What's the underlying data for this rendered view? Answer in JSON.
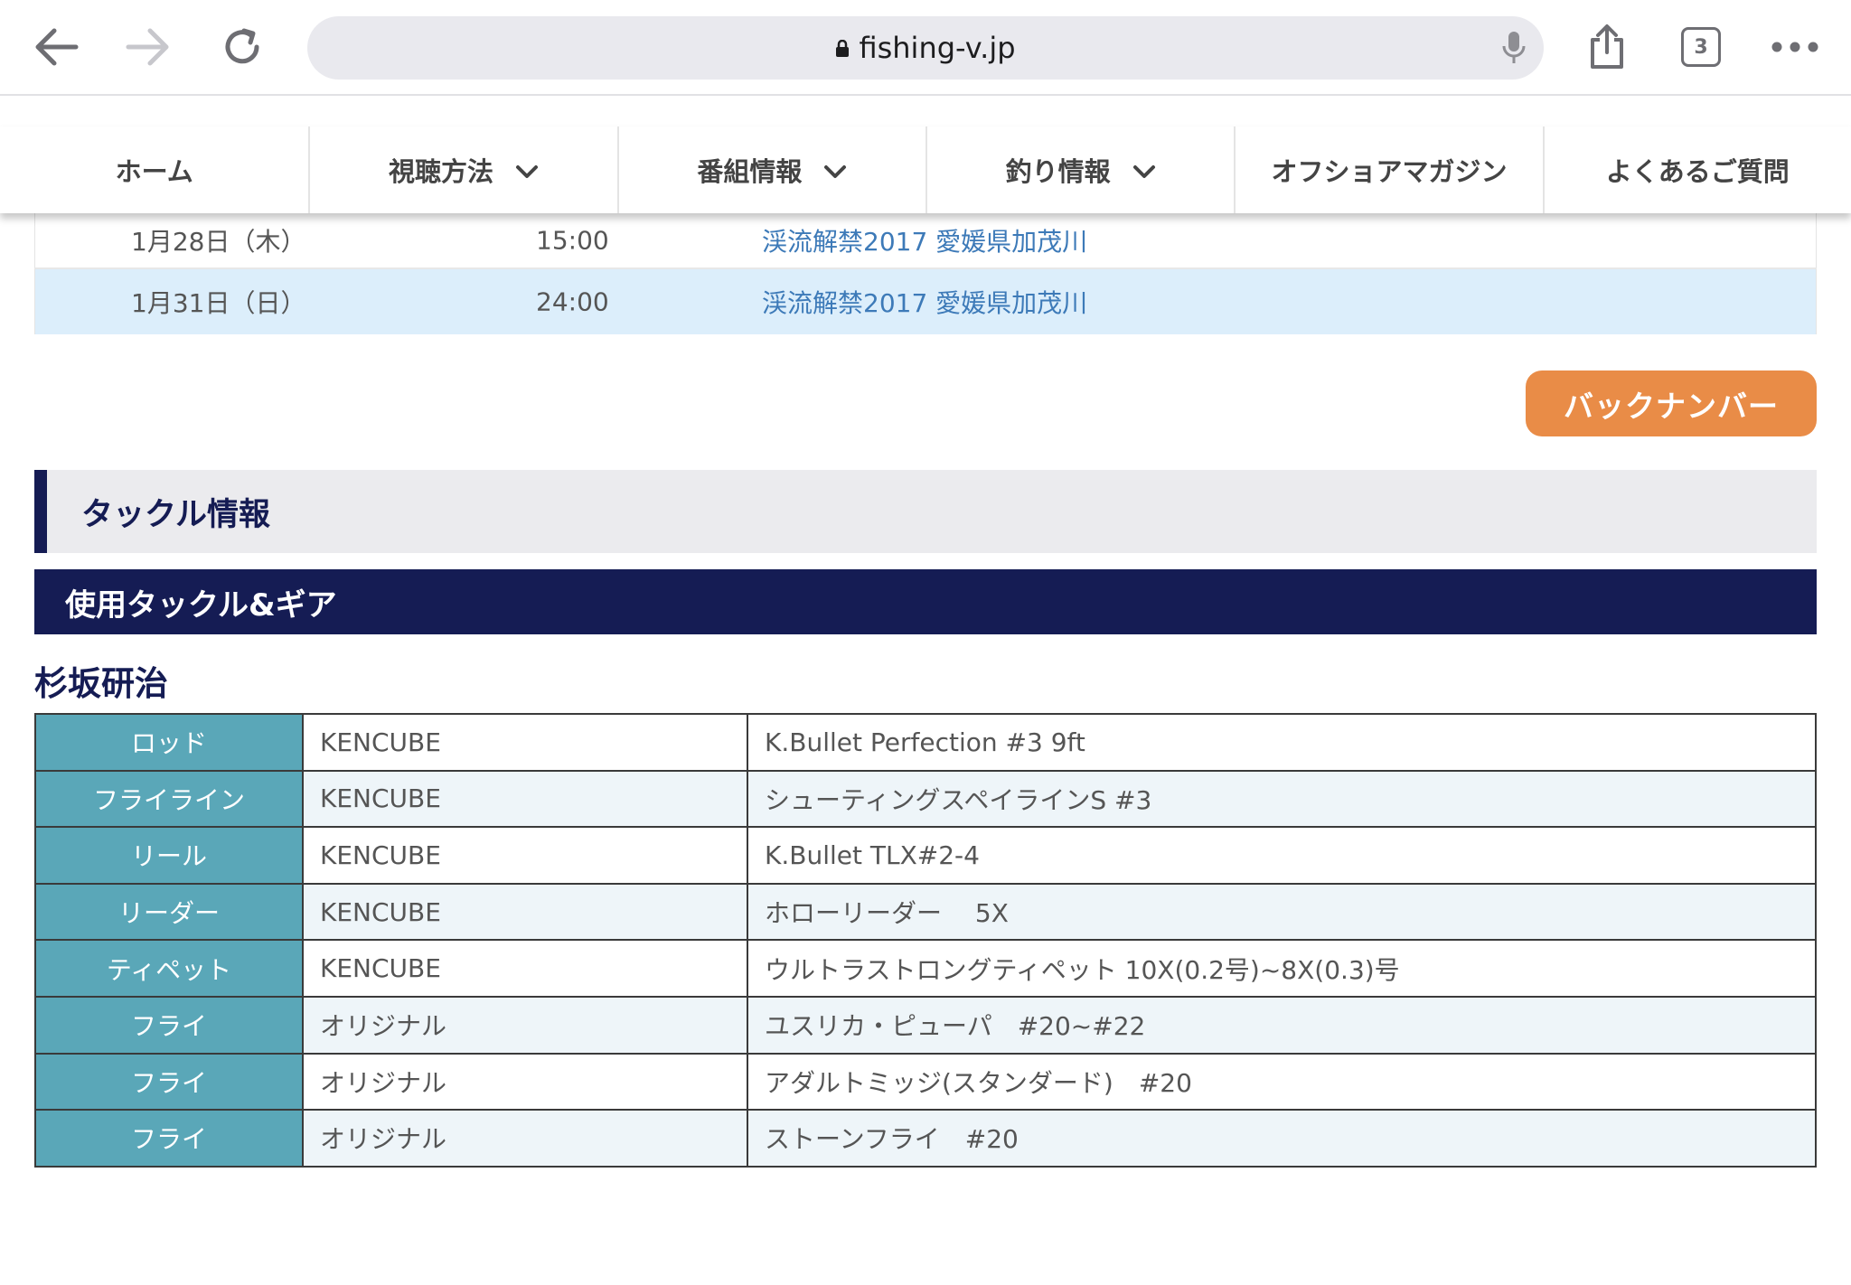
{
  "browser": {
    "url": "fishing-v.jp",
    "tab_count": "3"
  },
  "nav": {
    "items": [
      {
        "label": "ホーム",
        "dropdown": false
      },
      {
        "label": "視聴方法",
        "dropdown": true
      },
      {
        "label": "番組情報",
        "dropdown": true
      },
      {
        "label": "釣り情報",
        "dropdown": true
      },
      {
        "label": "オフショアマガジン",
        "dropdown": false
      },
      {
        "label": "よくあるご質問",
        "dropdown": false
      }
    ]
  },
  "schedule": [
    {
      "date": "1月28日（木）",
      "time": "15:00",
      "program": "渓流解禁2017 愛媛県加茂川"
    },
    {
      "date": "1月31日（日）",
      "time": "24:00",
      "program": "渓流解禁2017 愛媛県加茂川"
    }
  ],
  "back_number_label": "バックナンバー",
  "section_title": "タックル情報",
  "subsection_title": "使用タックル&ギア",
  "person_name": "杉坂研治",
  "tackle": [
    {
      "category": "ロッド",
      "maker": "KENCUBE",
      "item": "K.Bullet Perfection #3 9ft"
    },
    {
      "category": "フライライン",
      "maker": "KENCUBE",
      "item": "シューティングスペイラインS #3"
    },
    {
      "category": "リール",
      "maker": "KENCUBE",
      "item": "K.Bullet TLX#2-4"
    },
    {
      "category": "リーダー",
      "maker": "KENCUBE",
      "item": "ホローリーダー　 5X"
    },
    {
      "category": "ティペット",
      "maker": "KENCUBE",
      "item": "ウルトラストロングティペット 10X(0.2号)~8X(0.3)号"
    },
    {
      "category": "フライ",
      "maker": "オリジナル",
      "item": "ユスリカ・ピューパ　#20~#22"
    },
    {
      "category": "フライ",
      "maker": "オリジナル",
      "item": "アダルトミッジ(スタンダード)　#20"
    },
    {
      "category": "フライ",
      "maker": "オリジナル",
      "item": "ストーンフライ　#20"
    }
  ],
  "colors": {
    "navy": "#151c54",
    "teal_cell": "#5aa7b8",
    "orange_button": "#e98c47",
    "link_blue": "#3d7ab8"
  }
}
